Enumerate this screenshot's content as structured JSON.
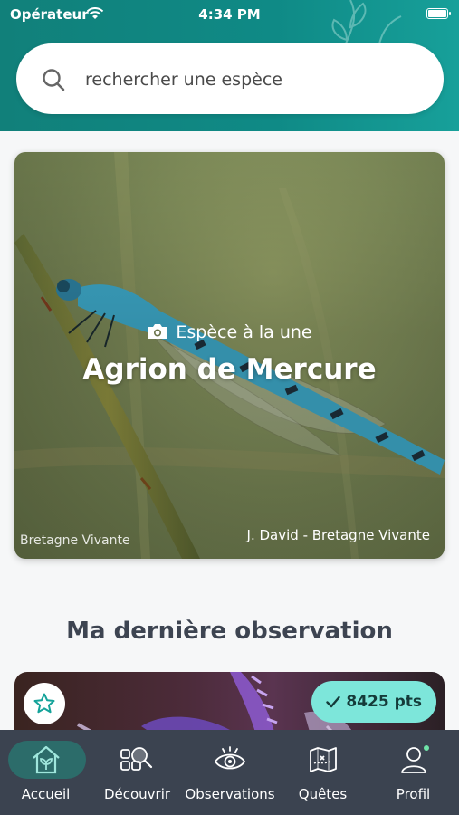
{
  "status_bar": {
    "carrier": "Opérateur",
    "time": "4:34 PM"
  },
  "search": {
    "placeholder": "rechercher une espèce",
    "icon": "search-icon"
  },
  "featured": {
    "label": "Espèce à la une",
    "title": "Agrion de Mercure",
    "credit_left": "Bretagne Vivante",
    "credit_right": "J. David - Bretagne Vivante"
  },
  "last_observation": {
    "section_title": "Ma dernière observation",
    "points": "8425 pts"
  },
  "tabbar": {
    "items": [
      {
        "label": "Accueil",
        "icon": "house-icon",
        "active": true
      },
      {
        "label": "Découvrir",
        "icon": "discover-icon",
        "active": false
      },
      {
        "label": "Observations",
        "icon": "eye-icon",
        "active": false
      },
      {
        "label": "Quêtes",
        "icon": "map-icon",
        "active": false
      },
      {
        "label": "Profil",
        "icon": "user-icon",
        "active": false
      }
    ]
  },
  "colors": {
    "header_teal": "#0f8a86",
    "tabbar": "#3b4350",
    "active_pill": "#2c6c6a",
    "points_badge": "#7de6da"
  }
}
